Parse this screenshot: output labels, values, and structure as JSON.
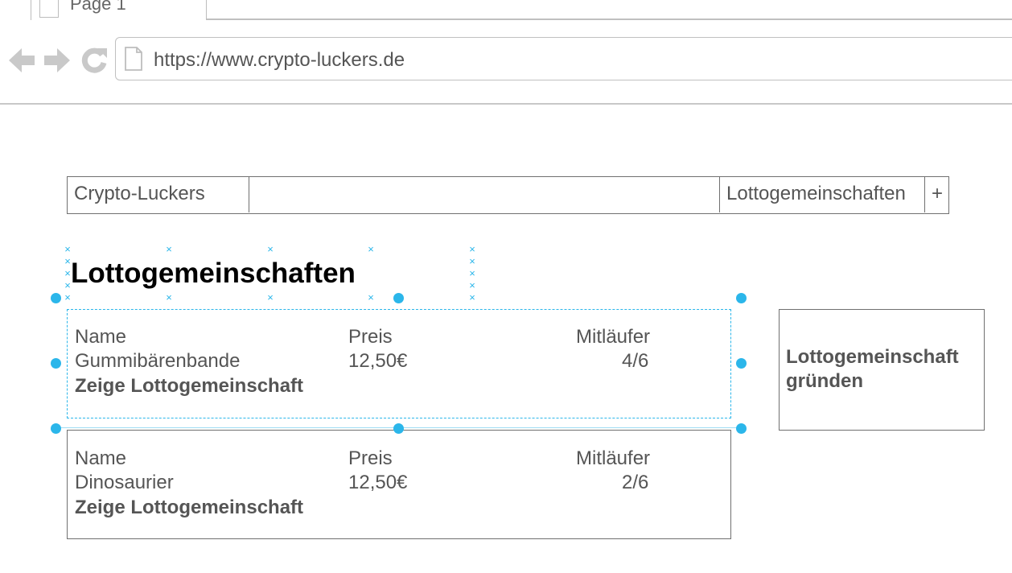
{
  "browser": {
    "tab_title": "Page 1",
    "url": "https://www.crypto-luckers.de",
    "icons": {
      "tab": "document-icon",
      "url": "document-icon",
      "back": "arrow-left-icon",
      "forward": "arrow-right-icon",
      "reload": "reload-icon"
    }
  },
  "site_nav": {
    "brand": "Crypto-Luckers",
    "link": "Lottogemeinschaften",
    "plus": "+"
  },
  "page": {
    "heading": "Lottogemeinschaften"
  },
  "groups": [
    {
      "name_label": "Name",
      "price_label": "Preis",
      "members_label": "Mitläufer",
      "name": "Gummibärenbande",
      "price": "12,50€",
      "members": "4/6",
      "link": "Zeige Lottogemeinschaft"
    },
    {
      "name_label": "Name",
      "price_label": "Preis",
      "members_label": "Mitläufer",
      "name": "Dinosaurier",
      "price": "12,50€",
      "members": "2/6",
      "link": "Zeige Lottogemeinschaft"
    }
  ],
  "sidebox": {
    "label": "Lottogemeinschaft gründen"
  },
  "colors": {
    "selection": "#2bb6ea",
    "border": "#707070",
    "text": "#555555",
    "heading": "#000000"
  }
}
